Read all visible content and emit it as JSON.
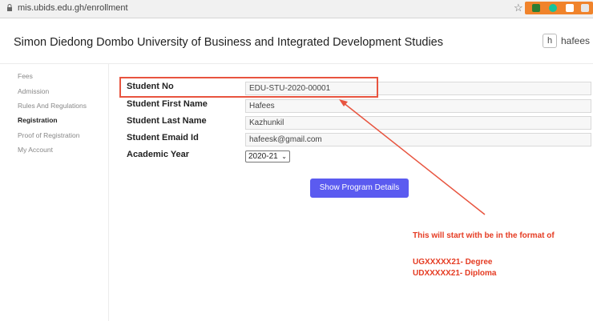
{
  "browser": {
    "url": "mis.ubids.edu.gh/enrollment"
  },
  "header": {
    "title": "Simon Diedong Dombo University of Business and Integrated Development Studies",
    "user_initial": "h",
    "user_name": "hafees"
  },
  "sidebar": {
    "items": [
      {
        "label": "Fees"
      },
      {
        "label": "Admission"
      },
      {
        "label": "Rules And Regulations"
      },
      {
        "label": "Registration"
      },
      {
        "label": "Proof of Registration"
      },
      {
        "label": "My Account"
      }
    ],
    "active": "Registration"
  },
  "form": {
    "student_no": {
      "label": "Student No",
      "value": "EDU-STU-2020-00001"
    },
    "first_name": {
      "label": "Student First Name",
      "value": "Hafees"
    },
    "last_name": {
      "label": "Student Last Name",
      "value": "Kazhunkil"
    },
    "email": {
      "label": "Student Emaid Id",
      "value": "hafeesk@gmail.com"
    },
    "academic_year": {
      "label": "Academic Year",
      "value": "2020-21"
    },
    "button_label": "Show Program Details"
  },
  "annotation": {
    "line1": "This will start with be in the format of",
    "line2": "UGXXXXX21- Degree",
    "line3": "UDXXXXX21- Diploma",
    "color": "#e53b22"
  }
}
